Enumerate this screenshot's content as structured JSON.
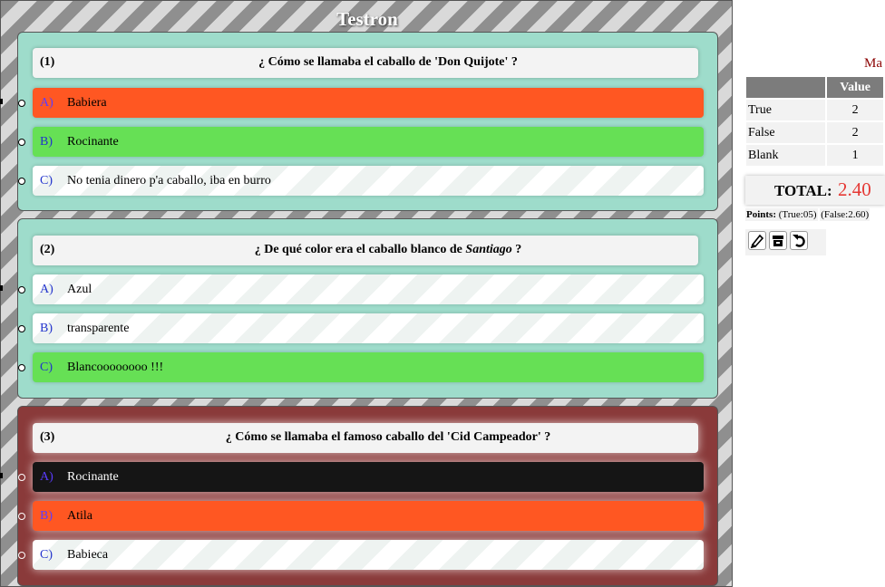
{
  "app": {
    "title": "Testron"
  },
  "questions": [
    {
      "number": "(1)",
      "text": "¿ Cómo se llamaba el caballo de 'Don Quijote' ?",
      "options": [
        {
          "letter": "A)",
          "text": "Babiera",
          "state": "wrong-selected"
        },
        {
          "letter": "B)",
          "text": "Rocinante",
          "state": "correct"
        },
        {
          "letter": "C)",
          "text": "No tenia dinero p'a caballo, iba en burro",
          "state": "none"
        }
      ]
    },
    {
      "number": "(2)",
      "text_before": "¿ De qué color era el caballo blanco de ",
      "text_emph": "Santiago",
      "text_after": " ?",
      "options": [
        {
          "letter": "A)",
          "text": "Azul",
          "state": "none"
        },
        {
          "letter": "B)",
          "text": "transparente",
          "state": "none"
        },
        {
          "letter": "C)",
          "text": "Blancoooooooo !!!",
          "state": "correct"
        }
      ]
    },
    {
      "number": "(3)",
      "text": "¿ Cómo se llamaba el famoso caballo del 'Cid Campeador' ?",
      "options": [
        {
          "letter": "A)",
          "text": "Rocinante",
          "state": "blank"
        },
        {
          "letter": "B)",
          "text": "Atila",
          "state": "wrong-selected"
        },
        {
          "letter": "C)",
          "text": "Babieca",
          "state": "none"
        }
      ]
    }
  ],
  "sidebar": {
    "heading": "Ma",
    "table": {
      "value_header": "Value",
      "rows": [
        {
          "label": "True",
          "value": "2"
        },
        {
          "label": "False",
          "value": "2"
        },
        {
          "label": "Blank",
          "value": "1"
        }
      ]
    },
    "total_label": "TOTAL:",
    "total_value": "2.40",
    "points_label": "Points:",
    "points_true": "(True:05)",
    "points_false": "(False:2.60)",
    "tools": [
      "edit-icon",
      "archive-icon",
      "undo-icon"
    ]
  },
  "colors": {
    "wrong": "#ff5722",
    "correct": "#66e055",
    "blank": "#151515",
    "total": "#e53935"
  }
}
